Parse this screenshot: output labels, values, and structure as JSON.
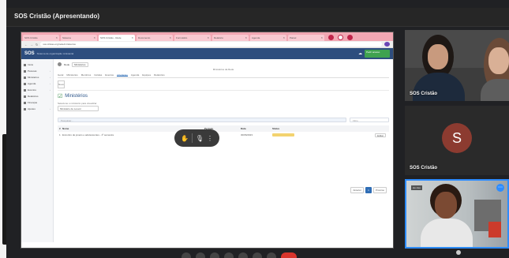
{
  "meeting": {
    "title": "SOS Cristão (Apresentando)"
  },
  "browser": {
    "tabs": [
      {
        "label": "SOS Cristão",
        "active": false
      },
      {
        "label": "Sistema",
        "active": false
      },
      {
        "label": "SOS Cristão - Rede",
        "active": true
      },
      {
        "label": "Documento",
        "active": false
      },
      {
        "label": "Formulário",
        "active": false
      },
      {
        "label": "Relatório",
        "active": false
      },
      {
        "label": "Agenda",
        "active": false
      },
      {
        "label": "Painel",
        "active": false
      }
    ],
    "url": "sos.cristao.org/rede/ministerios"
  },
  "app": {
    "logo": "SOS",
    "subtitle": "Sistema de organização ministerial",
    "header_button": "Pedir acesso",
    "sidebar": [
      {
        "label": "Início",
        "icon": "home-icon"
      },
      {
        "label": "Pessoas",
        "icon": "people-icon"
      },
      {
        "label": "Ministérios",
        "icon": "group-icon"
      },
      {
        "label": "Agenda",
        "icon": "calendar-icon"
      },
      {
        "label": "Eventos",
        "icon": "event-icon"
      },
      {
        "label": "Relatórios",
        "icon": "report-icon"
      },
      {
        "label": "Finanças",
        "icon": "money-icon"
      },
      {
        "label": "Ajustes",
        "icon": "gear-icon"
      }
    ],
    "breadcrumb": [
      "Rede",
      "Ministérios"
    ],
    "page_header": "Ministérios da Rede",
    "content_tabs": [
      "Geral",
      "Ministérios",
      "Membros",
      "Células",
      "Eventos",
      "Atividades",
      "Agenda",
      "Equipes",
      "Relatórios"
    ],
    "active_content_tab": "Atividades",
    "small_button": "Novo",
    "section_title": "Ministérios",
    "hint": "Selecione o ministério para visualizar",
    "selector_value": "Ministério de Louvor",
    "search_placeholder": "Pesquisar...",
    "filter_placeholder": "Filtro",
    "table": {
      "headers": [
        "#",
        "Nome",
        "Período",
        "Data",
        "Status",
        ""
      ],
      "rows": [
        {
          "n": "1",
          "name": "Encontro de jovens e adolescentes - 1º semestre",
          "period": "01/01/2023",
          "date": "30/06/2023",
          "status": "pending",
          "action": "Editar"
        }
      ]
    },
    "pager": [
      "Anterior",
      "1",
      "Próximo"
    ]
  },
  "participants": [
    {
      "name": "SOS Cristão"
    },
    {
      "name": "SOS Cristão",
      "initial": "S"
    },
    {
      "name": "",
      "badge": "Ao vivo"
    }
  ]
}
